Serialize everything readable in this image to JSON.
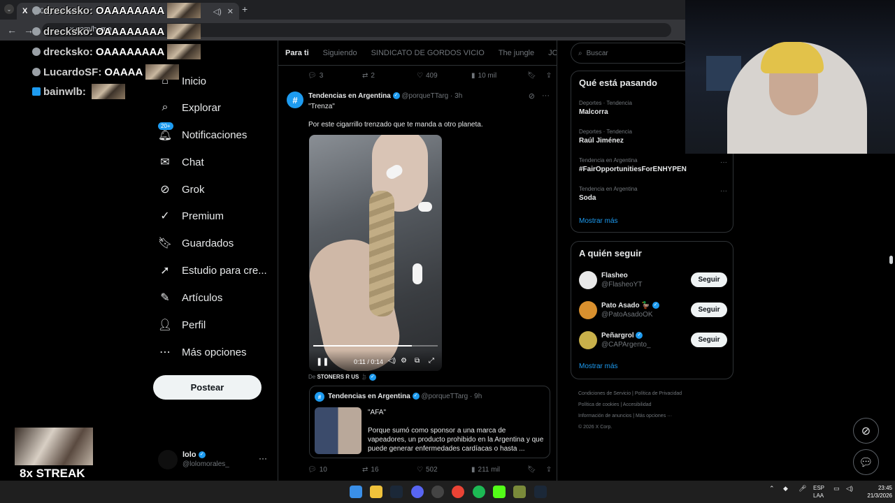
{
  "browser": {
    "tab_title": "(20+) Inicio / X",
    "url": "x.com/home"
  },
  "chat": [
    {
      "user": "drecksko:",
      "message": "OAAAAAAAA"
    },
    {
      "user": "drecksko:",
      "message": "OAAAAAAAA"
    },
    {
      "user": "drecksko:",
      "message": "OAAAAAAAA"
    },
    {
      "user": "LucardoSF:",
      "message": "OAAAA"
    },
    {
      "user": "bainwlb:",
      "message": ""
    }
  ],
  "nav": {
    "items": [
      {
        "label": "Inicio",
        "icon": "home-icon",
        "glyph": "⌂"
      },
      {
        "label": "Explorar",
        "icon": "search-icon",
        "glyph": "⌕"
      },
      {
        "label": "Notificaciones",
        "icon": "bell-icon",
        "glyph": "🔔︎",
        "badge": "20+"
      },
      {
        "label": "Chat",
        "icon": "mail-icon",
        "glyph": "✉"
      },
      {
        "label": "Grok",
        "icon": "grok-icon",
        "glyph": "⊘"
      },
      {
        "label": "Premium",
        "icon": "verified-icon",
        "glyph": "✓"
      },
      {
        "label": "Guardados",
        "icon": "bookmark-icon",
        "glyph": "🔖︎"
      },
      {
        "label": "Estudio para cre...",
        "icon": "rocket-icon",
        "glyph": "➚"
      },
      {
        "label": "Artículos",
        "icon": "article-icon",
        "glyph": "✎"
      },
      {
        "label": "Perfil",
        "icon": "person-icon",
        "glyph": "👤︎"
      },
      {
        "label": "Más opciones",
        "icon": "more-circle-icon",
        "glyph": "⋯"
      }
    ],
    "post_button": "Postear"
  },
  "account": {
    "name": "lolo",
    "handle": "@lolomorales_"
  },
  "streak": {
    "label": "8x STREAK"
  },
  "timeline": {
    "tabs": [
      "Para ti",
      "Siguiendo",
      "SINDICATO DE GORDOS VICIO",
      "The jungle",
      "JOSEO"
    ],
    "top_actions": {
      "replies": "3",
      "reposts": "2",
      "likes": "409",
      "views": "10 mil"
    },
    "post": {
      "author": "Tendencias en Argentina",
      "handle": "@porqueTTarg",
      "time": "3h",
      "text1": "\"Trenza\"",
      "text2": "Por este cigarrillo trenzado que te manda a otro planeta.",
      "video_time": "0:11 / 0:14",
      "video_progress": 0.79,
      "source_prefix": "De",
      "source_name": "STONERS R US",
      "quote": {
        "author": "Tendencias en Argentina",
        "handle": "@porqueTTarg",
        "time": "9h",
        "text1": "\"AFA\"",
        "text2": "Porque sumó como sponsor a una marca de vapeadores, un producto prohibido en la Argentina y que puede generar enfermedades cardíacas o hasta ..."
      },
      "actions": {
        "replies": "10",
        "reposts": "16",
        "likes": "502",
        "views": "211 mil"
      }
    }
  },
  "right": {
    "search_placeholder": "Buscar",
    "trends_title": "Qué está pasando",
    "trends": [
      {
        "meta": "Deportes · Tendencia",
        "name": "Malcorra"
      },
      {
        "meta": "Deportes · Tendencia",
        "name": "Raúl Jiménez"
      },
      {
        "meta": "Tendencia en Argentina",
        "name": "#FairOpportunitiesForENHYPEN"
      },
      {
        "meta": "Tendencia en Argentina",
        "name": "Soda"
      }
    ],
    "show_more": "Mostrar más",
    "follow_title": "A quién seguir",
    "follow": [
      {
        "name": "Flasheo",
        "handle": "@FlasheoYT",
        "button": "Seguir",
        "color": "#e9e9e9"
      },
      {
        "name": "Pato Asado 🦆",
        "handle": "@PatoAsadoOK",
        "button": "Seguir",
        "color": "#d9902e"
      },
      {
        "name": "Peñargrol",
        "handle": "@CAPArgento_",
        "button": "Seguir",
        "color": "#c8b04a"
      }
    ],
    "footer": [
      "Condiciones de Servicio",
      "Política de Privacidad",
      "Política de cookies",
      "Accesibilidad",
      "Información de anuncios",
      "Más opciones ···",
      "© 2026 X Corp."
    ]
  },
  "taskbar": {
    "lang1": "ESP",
    "lang2": "LAA",
    "time": "23:45",
    "date": "21/3/2026"
  }
}
